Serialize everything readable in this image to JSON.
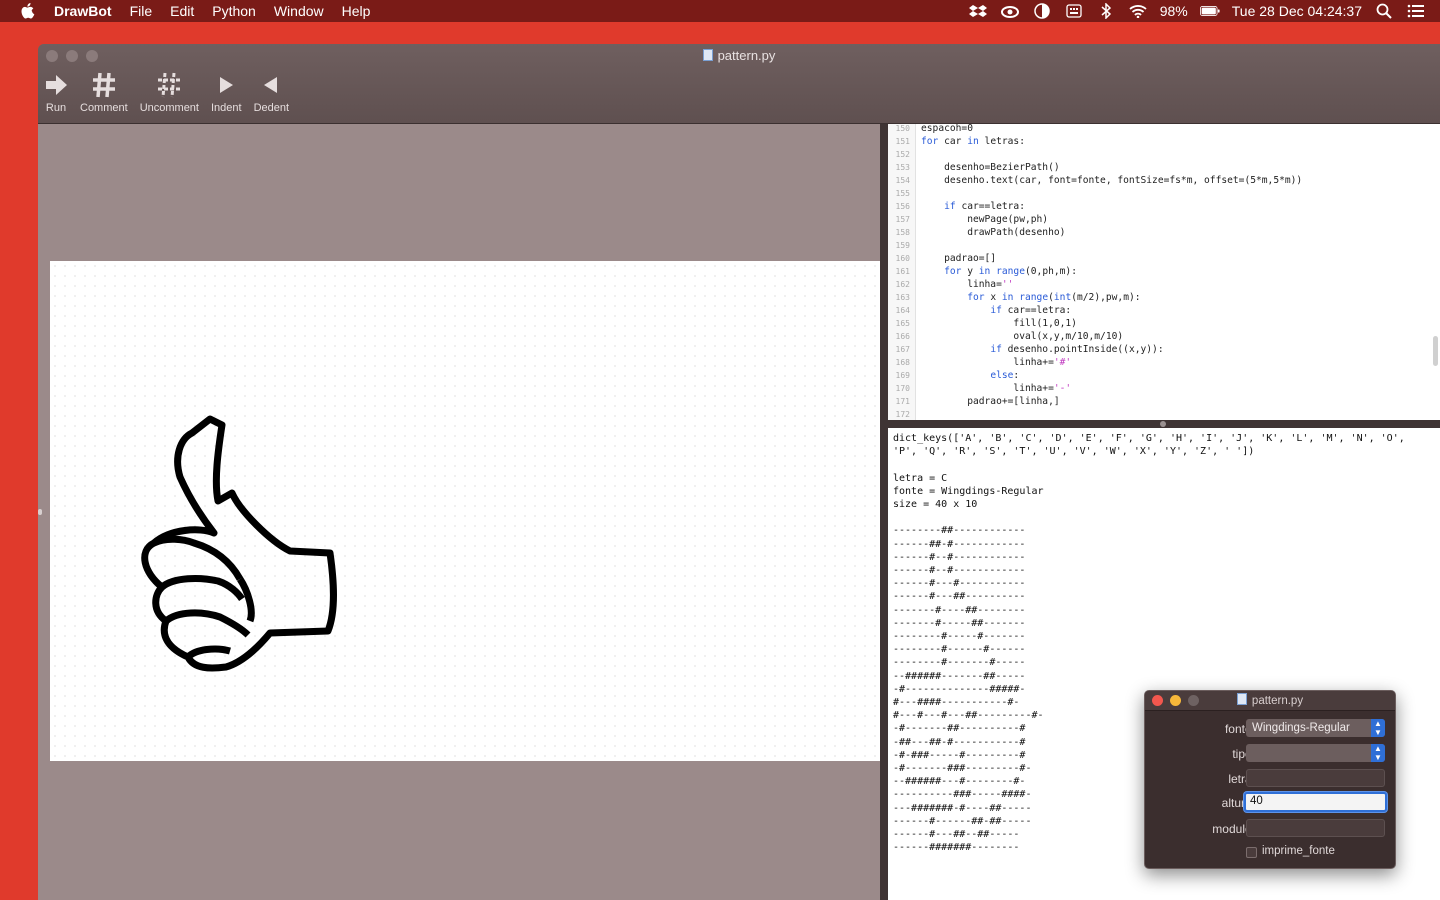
{
  "menubar": {
    "app_name": "DrawBot",
    "items": [
      "File",
      "Edit",
      "Python",
      "Window",
      "Help"
    ],
    "battery": "98%",
    "clock": "Tue 28 Dec  04:24:37"
  },
  "window": {
    "title": "pattern.py",
    "toolbar": [
      {
        "label": "Run",
        "icon": "run-arrow-icon"
      },
      {
        "label": "Comment",
        "icon": "hash-icon"
      },
      {
        "label": "Uncomment",
        "icon": "hash-strike-icon"
      },
      {
        "label": "Indent",
        "icon": "indent-triangle-icon"
      },
      {
        "label": "Dedent",
        "icon": "dedent-triangle-icon"
      }
    ]
  },
  "editor": {
    "lines": [
      {
        "n": "150",
        "code": "espacoh=0"
      },
      {
        "n": "151",
        "code": "for car in letras:"
      },
      {
        "n": "152",
        "code": ""
      },
      {
        "n": "153",
        "code": "    desenho=BezierPath()"
      },
      {
        "n": "154",
        "code": "    desenho.text(car, font=fonte, fontSize=fs*m, offset=(5*m,5*m))"
      },
      {
        "n": "155",
        "code": ""
      },
      {
        "n": "156",
        "code": "    if car==letra:"
      },
      {
        "n": "157",
        "code": "        newPage(pw,ph)"
      },
      {
        "n": "158",
        "code": "        drawPath(desenho)"
      },
      {
        "n": "159",
        "code": ""
      },
      {
        "n": "160",
        "code": "    padrao=[]"
      },
      {
        "n": "161",
        "code": "    for y in range(0,ph,m):"
      },
      {
        "n": "162",
        "code": "        linha=''"
      },
      {
        "n": "163",
        "code": "        for x in range(int(m/2),pw,m):"
      },
      {
        "n": "164",
        "code": "            if car==letra:"
      },
      {
        "n": "165",
        "code": "                fill(1,0,1)"
      },
      {
        "n": "166",
        "code": "                oval(x,y,m/10,m/10)"
      },
      {
        "n": "167",
        "code": "            if desenho.pointInside((x,y)):"
      },
      {
        "n": "168",
        "code": "                linha+='#'"
      },
      {
        "n": "169",
        "code": "            else:"
      },
      {
        "n": "170",
        "code": "                linha+='-'"
      },
      {
        "n": "171",
        "code": "        padrao+=[linha,]"
      },
      {
        "n": "172",
        "code": ""
      }
    ]
  },
  "console": {
    "lines": [
      "dict_keys(['A', 'B', 'C', 'D', 'E', 'F', 'G', 'H', 'I', 'J', 'K', 'L', 'M', 'N', 'O',",
      "'P', 'Q', 'R', 'S', 'T', 'U', 'V', 'W', 'X', 'Y', 'Z', ' '])",
      "",
      "letra = C",
      "fonte = Wingdings-Regular",
      "size = 40 x 10",
      "",
      "--------##------------",
      "------##-#------------",
      "------#--#------------",
      "------#--#------------",
      "------#---#-----------",
      "------#---##----------",
      "-------#----##--------",
      "-------#-----##-------",
      "--------#-----#-------",
      "--------#------#------",
      "--------#-------#-----",
      "--######-------##-----",
      "-#--------------#####-",
      "#---####-----------#-",
      "#---#---#---##---------#-",
      "-#-------##----------#",
      "-##---##-#-----------#",
      "-#-###-----#---------#",
      "-#-------###---------#-",
      "--######---#--------#-",
      "----------###-----####-",
      "---#######-#----##-----",
      "------#------##-##-----",
      "------#---##--##-----",
      "------#######--------"
    ]
  },
  "panel": {
    "title": "pattern.py",
    "fonte_label": "fonte:",
    "fonte_value": "Wingdings-Regular",
    "tipo_label": "tipo:",
    "tipo_value": "",
    "letra_label": "letra:",
    "letra_value": "",
    "altura_label": "altura:",
    "altura_value": "40",
    "modulo_label": "modulo:",
    "modulo_value": "",
    "checkbox_label": "imprime_fonte"
  }
}
